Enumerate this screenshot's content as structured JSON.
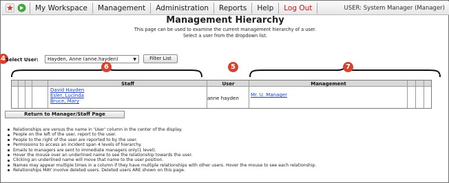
{
  "nav": {
    "items": [
      {
        "label": "My Workspace"
      },
      {
        "label": "Management"
      },
      {
        "label": "Administration"
      },
      {
        "label": "Reports"
      },
      {
        "label": "Help"
      },
      {
        "label": "Log Out"
      }
    ],
    "user_label": "USER: System Manager (Manager)",
    "icons": [
      "star-icon",
      "go-icon"
    ]
  },
  "header": {
    "title": "Management Hierarchy",
    "subtitle_1": "This page can be used to examine the current management hierarchy of a user.",
    "subtitle_2": "Select a user from the dropdown list."
  },
  "filter": {
    "select_label": "Select User:",
    "selected_user": "Hayden, Anne (anne.hayden)",
    "filter_button": "Filter List"
  },
  "callouts": {
    "four": "4",
    "five": "5",
    "six": "6",
    "seven": "7",
    "color": "#d9412c"
  },
  "table": {
    "headers": {
      "staff": "Staff",
      "user": "User",
      "management": "Management"
    },
    "staff": [
      "David Hayden",
      "Esler, Lucinda",
      "Bruce, Mary"
    ],
    "user": "anne hayden",
    "management": [
      "Mr. U. Manager"
    ]
  },
  "return_button": "Return to Manager/Staff Page",
  "notes": [
    "Relationships are versus the name in 'User' column in the center of the display.",
    "People on the left of the user, report to the user.",
    "People to the right of the user are reported to by the user.",
    "Permissions to access an incident span 4 levels of hierarchy.",
    "Emails to managers are sent to immediate managers only(1 level).",
    "Hover the mouse over an underlined name to see the relationship towards the user.",
    "Clicking an underlined name will move that name to the user position.",
    "Names may appear multiple times in a column if they have multiple relationships with other users. Hover the mouse to see each relationship.",
    "Relationships MAY involve deleted users. Deleted users ARE shown on this page."
  ],
  "colors": {
    "link": "#1a3ec9",
    "logout": "#d21414",
    "header_bg": "#d9d9d9"
  }
}
